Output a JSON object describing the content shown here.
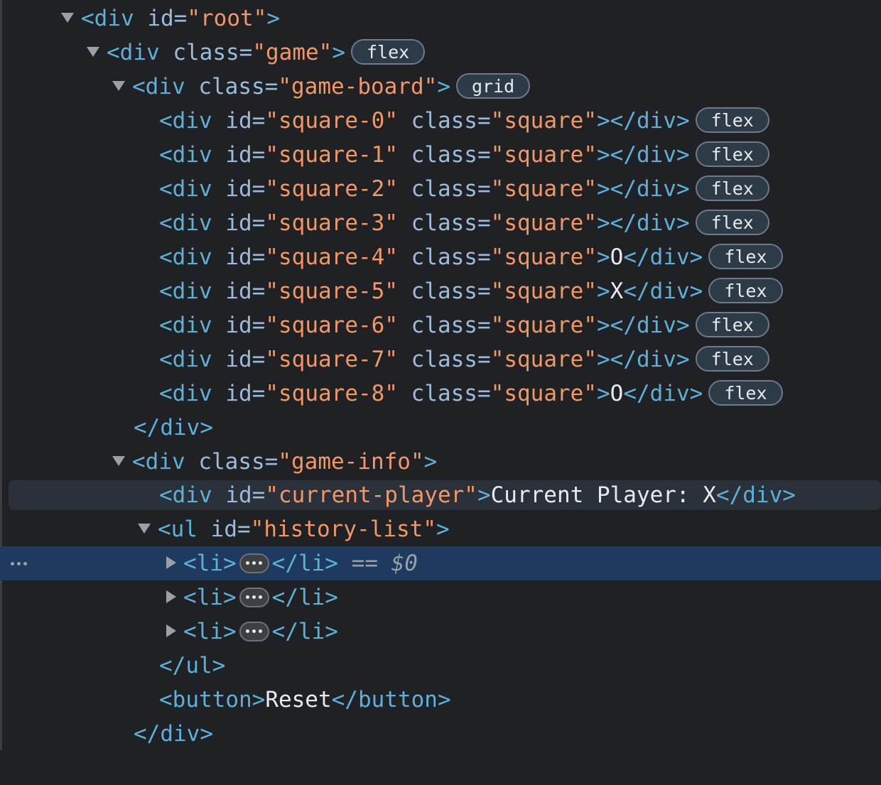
{
  "tree": {
    "root": {
      "open": "<div",
      "attr": "id",
      "value": "root",
      "close": ">"
    },
    "game": {
      "open": "<div",
      "attr": "class",
      "value": "game",
      "close": ">",
      "badge": "flex"
    },
    "board": {
      "open": "<div",
      "attr": "class",
      "value": "game-board",
      "close": ">",
      "badge": "grid"
    },
    "squares": [
      {
        "id": "square-0",
        "class": "square",
        "text": "",
        "badge": "flex"
      },
      {
        "id": "square-1",
        "class": "square",
        "text": "",
        "badge": "flex"
      },
      {
        "id": "square-2",
        "class": "square",
        "text": "",
        "badge": "flex"
      },
      {
        "id": "square-3",
        "class": "square",
        "text": "",
        "badge": "flex"
      },
      {
        "id": "square-4",
        "class": "square",
        "text": "O",
        "badge": "flex"
      },
      {
        "id": "square-5",
        "class": "square",
        "text": "X",
        "badge": "flex"
      },
      {
        "id": "square-6",
        "class": "square",
        "text": "",
        "badge": "flex"
      },
      {
        "id": "square-7",
        "class": "square",
        "text": "",
        "badge": "flex"
      },
      {
        "id": "square-8",
        "class": "square",
        "text": "O",
        "badge": "flex"
      }
    ],
    "board_close": "</div>",
    "info": {
      "open": "<div",
      "attr": "class",
      "value": "game-info",
      "close": ">"
    },
    "current_player": {
      "open": "<div",
      "attr": "id",
      "value": "current-player",
      "close": ">",
      "text": "Current Player: X",
      "end": "</div>"
    },
    "history": {
      "open": "<ul",
      "attr": "id",
      "value": "history-list",
      "close": ">"
    },
    "history_items": [
      {
        "open": "<li>",
        "close": "</li>",
        "suffix": "== $0",
        "selected": true
      },
      {
        "open": "<li>",
        "close": "</li>",
        "suffix": "",
        "selected": false
      },
      {
        "open": "<li>",
        "close": "</li>",
        "suffix": "",
        "selected": false
      }
    ],
    "ul_close": "</ul>",
    "button": {
      "open": "<button>",
      "text": "Reset",
      "close": "</button>"
    },
    "info_close": "</div>"
  },
  "colors": {
    "background": "#202124",
    "tag": "#5db0d7",
    "attribute": "#9bbbdc",
    "value": "#f29766",
    "selected_row": "#1f3a5f"
  }
}
